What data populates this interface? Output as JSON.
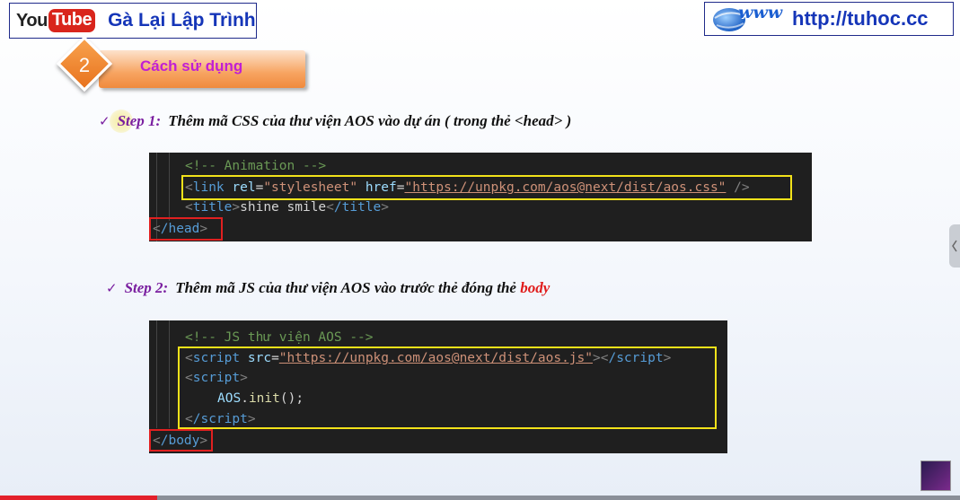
{
  "header": {
    "youtube_you": "You",
    "youtube_tube": "Tube",
    "channel_name": "Gà Lại Lập Trình",
    "www_logo_text": "www",
    "site_url": "http://tuhoc.cc"
  },
  "section": {
    "number": "2",
    "title": "Cách sử dụng"
  },
  "steps": [
    {
      "check": "✓",
      "label": "Step 1:",
      "text": "Thêm mã CSS của thư viện AOS vào dự án ( trong thẻ <head> )",
      "highlight": ""
    },
    {
      "check": "✓",
      "label": "Step 2:",
      "text": "Thêm mã JS của thư viện AOS vào trước thẻ đóng thẻ",
      "highlight": "body"
    }
  ],
  "code_block_1": {
    "comment": "<!-- Animation -->",
    "link_open": "<",
    "link_tag": "link",
    "rel_attr": "rel",
    "rel_value": "\"stylesheet\"",
    "href_attr": "href",
    "href_value": "\"https://unpkg.com/aos@next/dist/aos.css\"",
    "link_close": "/>",
    "title_open": "title",
    "title_text": "shine smile",
    "title_close": "/title",
    "head_close": "/head"
  },
  "code_block_2": {
    "comment": "<!-- JS thư viện AOS -->",
    "script_tag": "script",
    "src_attr": "src",
    "src_value": "\"https://unpkg.com/aos@next/dist/aos.js\"",
    "script_close": "/script",
    "init_obj": "AOS",
    "init_fn": "init",
    "init_tail": "();",
    "body_close": "/body"
  },
  "player": {
    "progress": 0.164
  },
  "colors": {
    "youtube_red": "#d9251c",
    "brand_blue": "#1535b8",
    "section_orange": "#f08a3d",
    "section_title": "#c01fd4",
    "step_purple": "#7a1fa0",
    "highlight_red": "#e01b1b",
    "code_bg": "#1f1f1f",
    "box_yellow": "#f2e21a",
    "box_red": "#e02020"
  }
}
